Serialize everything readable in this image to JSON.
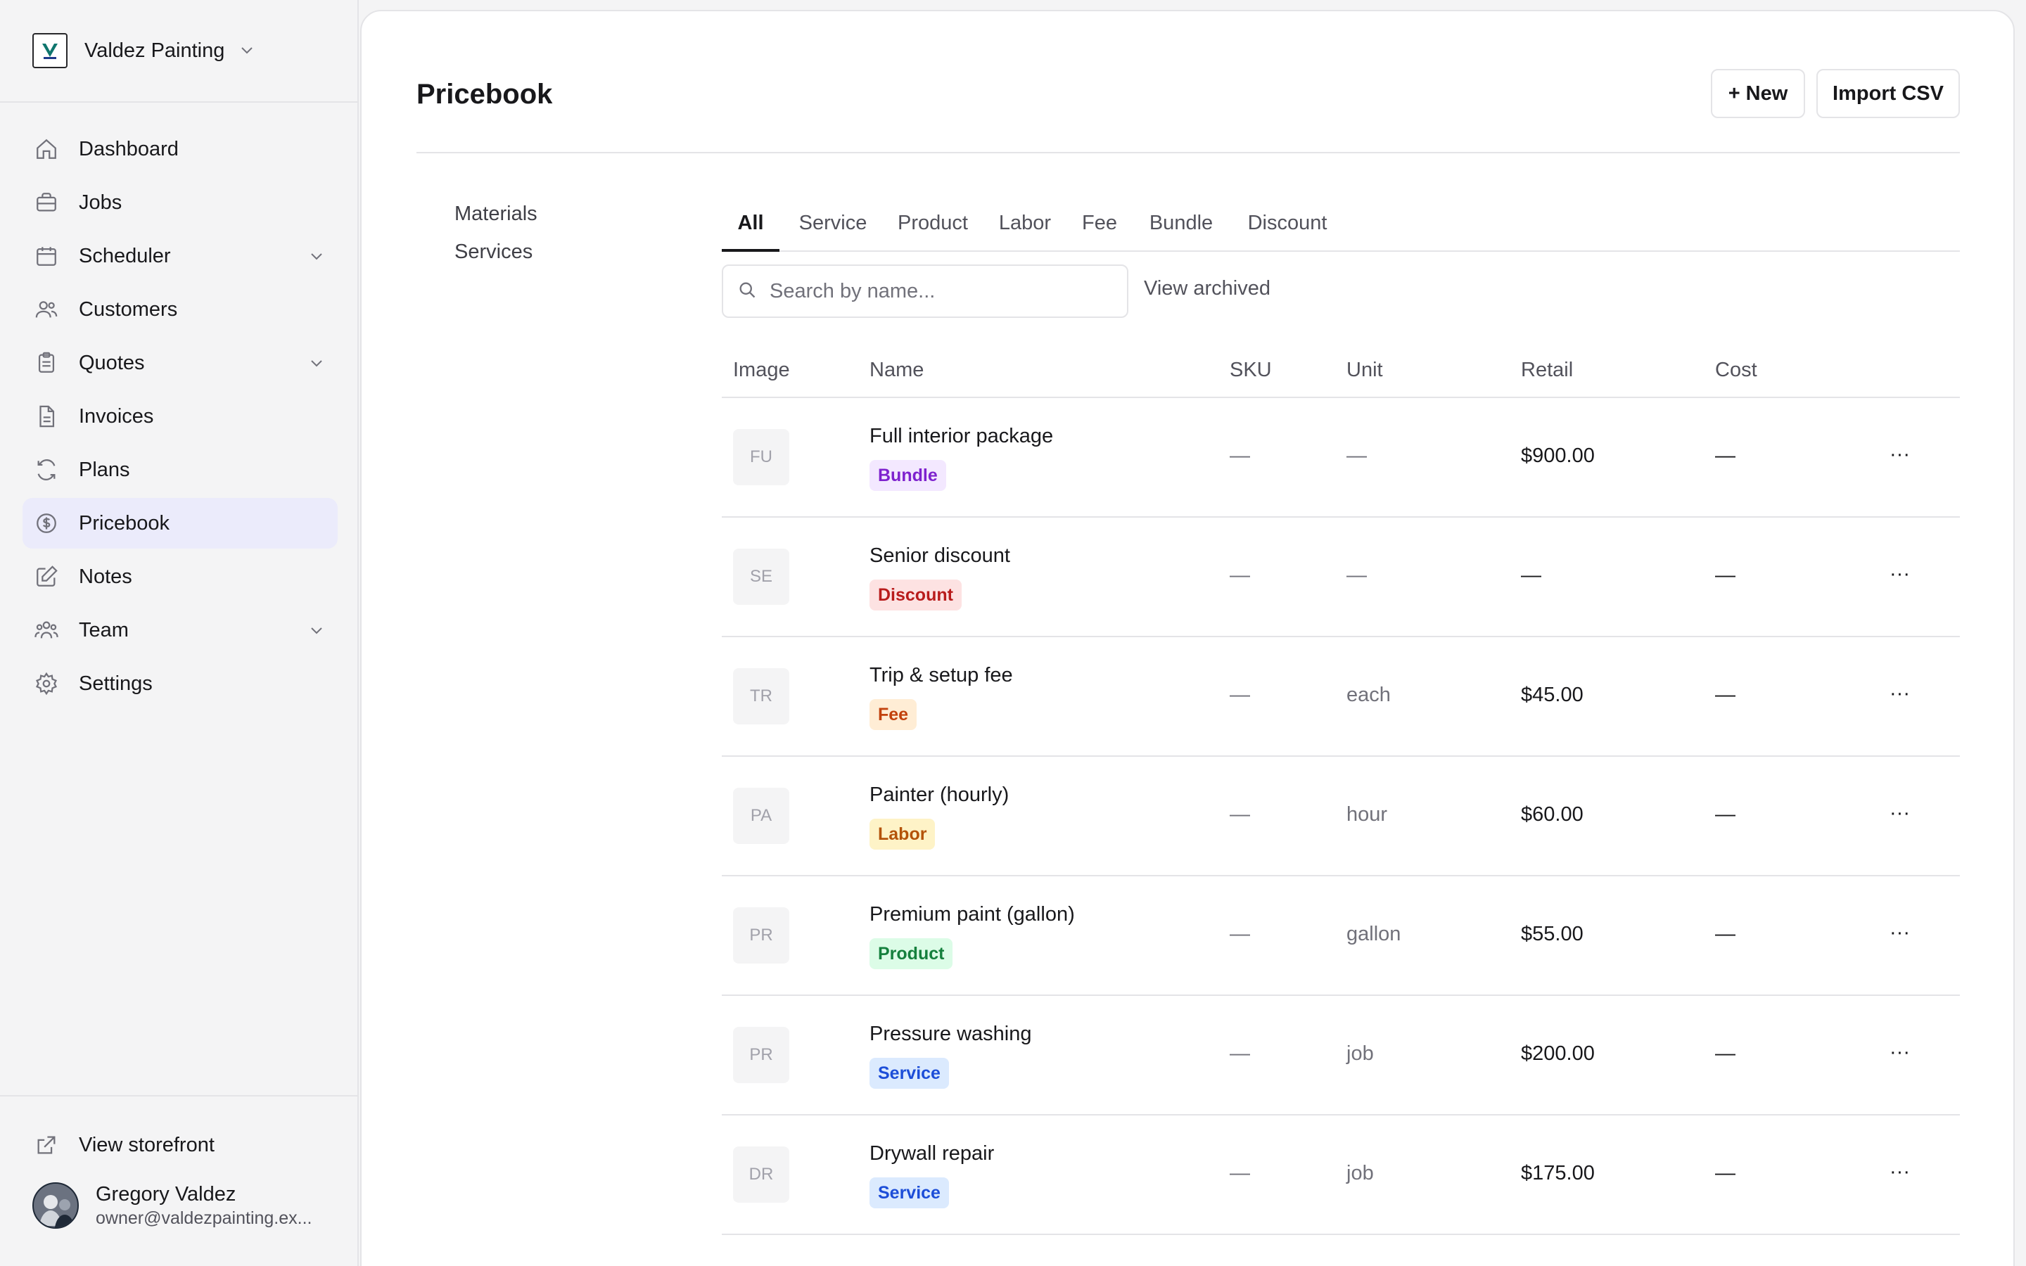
{
  "brand": {
    "name": "Valdez Painting"
  },
  "nav": [
    {
      "label": "Dashboard"
    },
    {
      "label": "Jobs"
    },
    {
      "label": "Scheduler"
    },
    {
      "label": "Customers"
    },
    {
      "label": "Quotes"
    },
    {
      "label": "Invoices"
    },
    {
      "label": "Plans"
    },
    {
      "label": "Pricebook"
    },
    {
      "label": "Notes"
    },
    {
      "label": "Team"
    },
    {
      "label": "Settings"
    }
  ],
  "storefront": {
    "label": "View storefront"
  },
  "user": {
    "name": "Gregory Valdez",
    "email": "owner@valdezpainting.ex..."
  },
  "page": {
    "title": "Pricebook",
    "new_label": "+ New",
    "import_label": "Import CSV"
  },
  "subnav": [
    {
      "label": "Materials"
    },
    {
      "label": "Services"
    }
  ],
  "tabs": [
    {
      "label": "All"
    },
    {
      "label": "Service"
    },
    {
      "label": "Product"
    },
    {
      "label": "Labor"
    },
    {
      "label": "Fee"
    },
    {
      "label": "Bundle"
    },
    {
      "label": "Discount"
    }
  ],
  "search": {
    "placeholder": "Search by name...",
    "view_archived": "View archived"
  },
  "table": {
    "headers": {
      "image": "Image",
      "name": "Name",
      "sku": "SKU",
      "unit": "Unit",
      "retail": "Retail",
      "cost": "Cost"
    },
    "rows": [
      {
        "initials": "FU",
        "name": "Full interior package",
        "badge": "Bundle",
        "sku": "—",
        "unit": "—",
        "retail": "$900.00",
        "cost": "—",
        "actions": "···"
      },
      {
        "initials": "SE",
        "name": "Senior discount",
        "badge": "Discount",
        "sku": "—",
        "unit": "—",
        "retail": "—",
        "cost": "—",
        "actions": "···"
      },
      {
        "initials": "TR",
        "name": "Trip & setup fee",
        "badge": "Fee",
        "sku": "—",
        "unit": "each",
        "retail": "$45.00",
        "cost": "—",
        "actions": "···"
      },
      {
        "initials": "PA",
        "name": "Painter (hourly)",
        "badge": "Labor",
        "sku": "—",
        "unit": "hour",
        "retail": "$60.00",
        "cost": "—",
        "actions": "···"
      },
      {
        "initials": "PR",
        "name": "Premium paint (gallon)",
        "badge": "Product",
        "sku": "—",
        "unit": "gallon",
        "retail": "$55.00",
        "cost": "—",
        "actions": "···"
      },
      {
        "initials": "PR",
        "name": "Pressure washing",
        "badge": "Service",
        "sku": "—",
        "unit": "job",
        "retail": "$200.00",
        "cost": "—",
        "actions": "···"
      },
      {
        "initials": "DR",
        "name": "Drywall repair",
        "badge": "Service",
        "sku": "—",
        "unit": "job",
        "retail": "$175.00",
        "cost": "—",
        "actions": "···"
      }
    ]
  },
  "colors": {
    "bundle": {
      "bg": "#f3e8ff",
      "fg": "#7e22ce"
    },
    "discount": {
      "bg": "#fde2e2",
      "fg": "#b91c1c"
    },
    "fee": {
      "bg": "#ffedd5",
      "fg": "#c2410c"
    },
    "labor": {
      "bg": "#fef3c7",
      "fg": "#b45309"
    },
    "product": {
      "bg": "#dcfce7",
      "fg": "#15803d"
    },
    "service": {
      "bg": "#dbeafe",
      "fg": "#1d4ed8"
    },
    "active_nav": "#ebebfb"
  }
}
